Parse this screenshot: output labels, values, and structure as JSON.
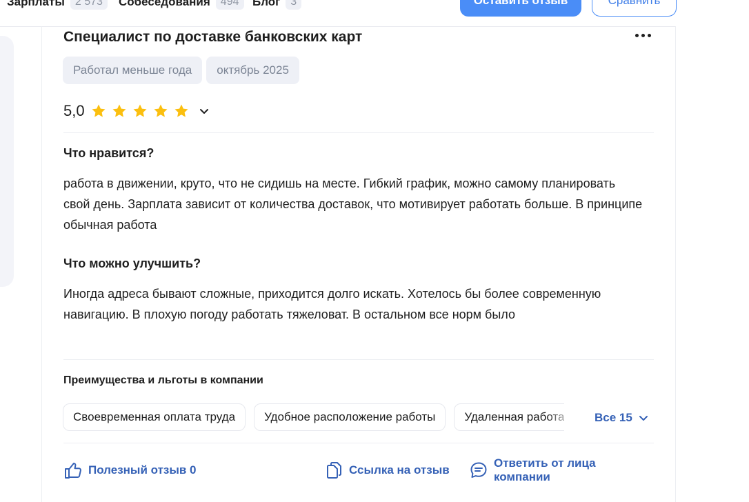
{
  "nav": {
    "items": [
      {
        "label": "Зарплаты",
        "count": "2 573"
      },
      {
        "label": "Собеседования",
        "count": "494"
      },
      {
        "label": "Блог",
        "count": "3"
      }
    ],
    "leave_review_button": "Оставить отзыв",
    "compare_button": "Сравнить"
  },
  "review": {
    "title": "Специалист по доставке банковских карт",
    "tags": [
      "Работал меньше года",
      "октябрь 2025"
    ],
    "rating": "5,0",
    "stars": 5,
    "likes_heading": "Что нравится?",
    "likes_text": "работа в движении, круто, что не сидишь на месте. Гибкий график, можно самому планировать свой день. Зарплата зависит от количества доставок, что мотивирует работать больше. В принципе обычная работа",
    "improve_heading": "Что можно улучшить?",
    "improve_text": "Иногда адреса бывают сложные, приходится долго искать. Хотелось бы более современную навигацию. В плохую погоду работать тяжеловат. В остальном все норм было",
    "benefits_heading": "Преимущества и льготы в компании",
    "benefits": [
      "Своевременная оплата труда",
      "Удобное расположение работы",
      "Удаленная работа"
    ],
    "all_benefits": "Все 15",
    "helpful": "Полезный отзыв 0",
    "link": "Ссылка на отзыв",
    "reply": "Ответить от лица компании"
  },
  "colors": {
    "accent": "#4a8df7",
    "link": "#3561b6",
    "star": "#fbbf0f",
    "tag_bg": "#eef0f6"
  }
}
